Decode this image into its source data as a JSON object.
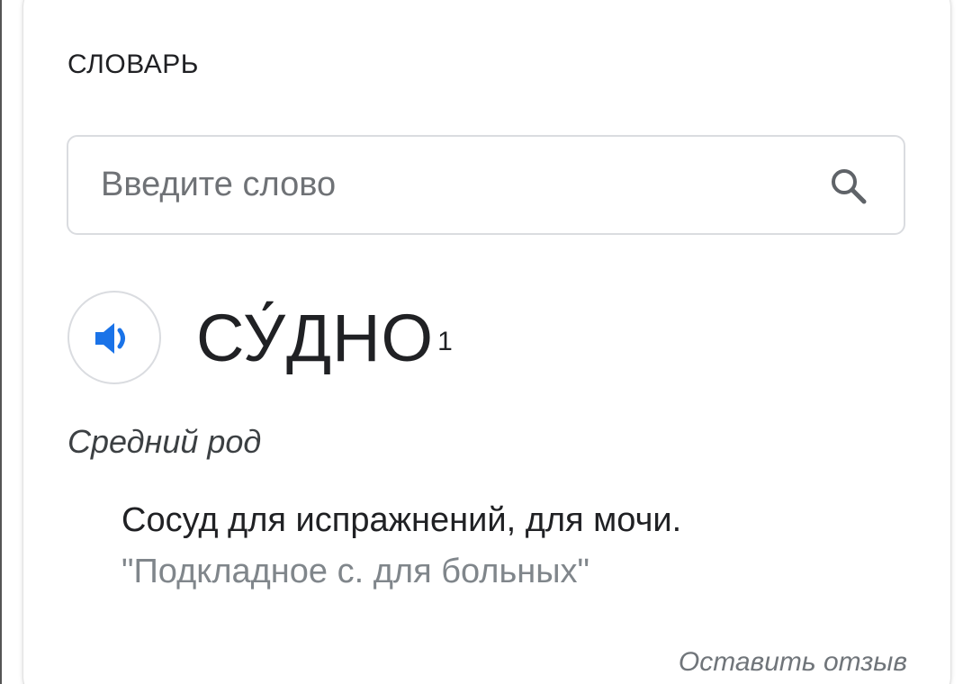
{
  "dictionary": {
    "section_title": "СЛОВАРЬ",
    "search": {
      "placeholder": "Введите слово",
      "value": "",
      "icon": "search-icon"
    },
    "entry": {
      "audio_icon": "speaker-icon",
      "headword": "СУ́ДНО",
      "homonym_number": "1",
      "part_of_speech": "Средний род",
      "definition": "Сосуд для испражнений, для мочи.",
      "example": "\"Подкладное с. для больных\""
    },
    "feedback_link": "Оставить отзыв"
  },
  "colors": {
    "accent_blue": "#1a73e8",
    "border": "#dadce0",
    "text_primary": "#202124",
    "text_secondary": "#80868b"
  }
}
